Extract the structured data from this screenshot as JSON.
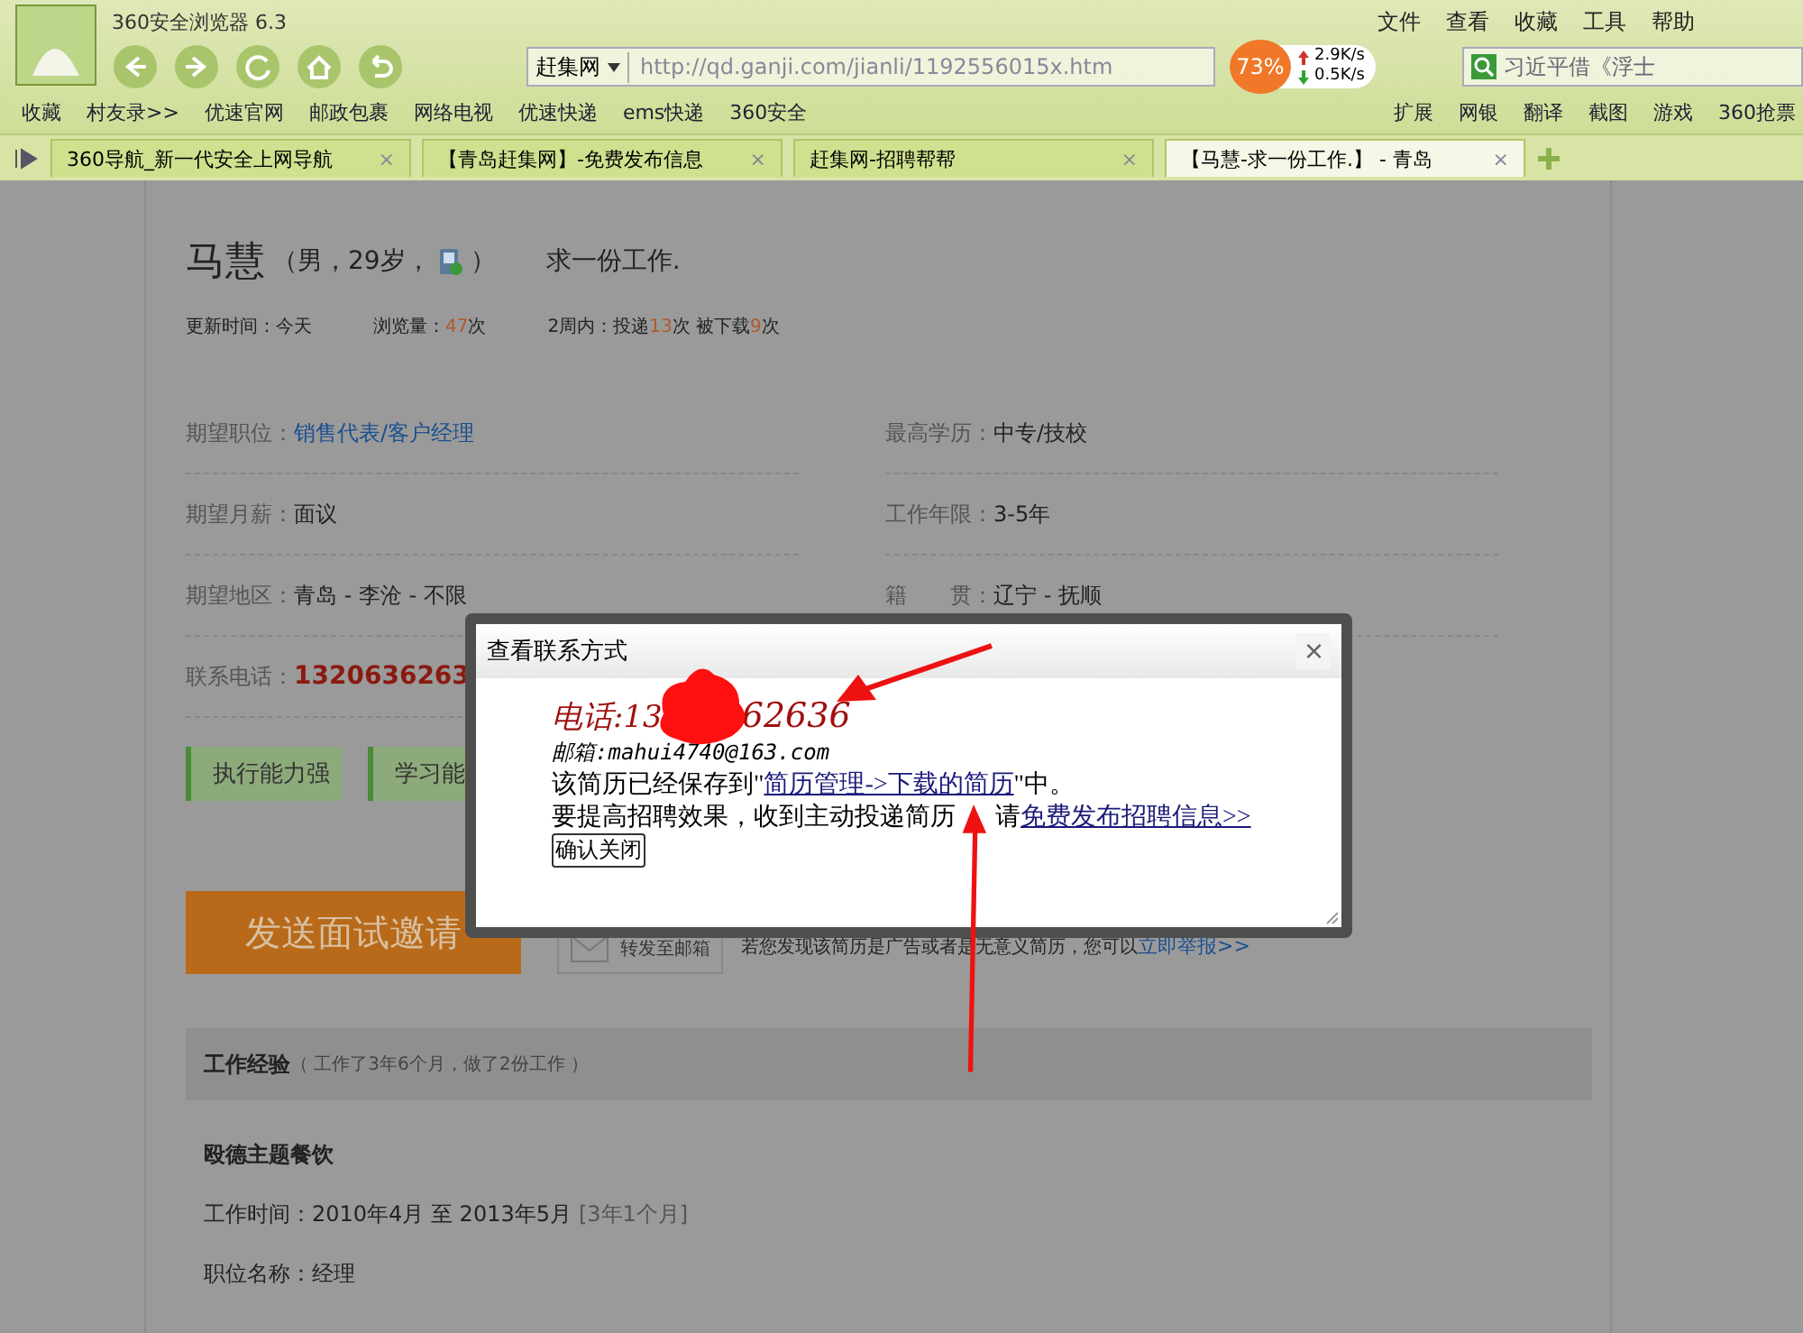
{
  "browser": {
    "title": "360安全浏览器 6.3",
    "menu": [
      "文件",
      "查看",
      "收藏",
      "工具",
      "帮助"
    ],
    "site_dropdown": "赶集网",
    "url": "http://qd.ganji.com/jianli/1192556015x.htm",
    "accelerator": "73%",
    "upload_speed": "2.9K/s",
    "download_speed": "0.5K/s",
    "search": "习近平借《浮士",
    "bookmarks": [
      "收藏",
      "村友录>>",
      "优速官网",
      "邮政包裹",
      "网络电视",
      "优速快递",
      "ems快递",
      "360安全"
    ],
    "tools": [
      "扩展",
      "网银",
      "翻译",
      "截图",
      "游戏",
      "360抢票"
    ],
    "tabs": [
      {
        "label": "360导航_新一代安全上网导航",
        "close": "×",
        "selected": false
      },
      {
        "label": "【青岛赶集网】-免费发布信息",
        "close": "×",
        "selected": false
      },
      {
        "label": "赶集网-招聘帮帮",
        "close": "×",
        "selected": false
      },
      {
        "label": "【马慧-求一份工作.】 - 青岛",
        "close": "×",
        "selected": true
      }
    ]
  },
  "profile": {
    "name": "马慧",
    "details_open": "（男，29岁，",
    "details_close": "）",
    "headline": "求一份工作.",
    "stats": [
      [
        {
          "kind": "text",
          "text": "更新时间：今天"
        }
      ],
      [
        {
          "kind": "text",
          "text": "浏览量："
        },
        {
          "kind": "number",
          "text": "47"
        },
        {
          "kind": "text",
          "text": "次"
        }
      ],
      [
        {
          "kind": "text",
          "text": "2周内：投递"
        },
        {
          "kind": "number",
          "text": "13"
        },
        {
          "kind": "text",
          "text": "次 被下载"
        },
        {
          "kind": "number",
          "text": "9"
        },
        {
          "kind": "text",
          "text": "次"
        }
      ]
    ],
    "fields": [
      {
        "label": "期望职位：",
        "value": "销售代表/客户经理",
        "kind": "link"
      },
      {
        "label": "最高学历：",
        "value": "中专/技校",
        "kind": "plain"
      },
      {
        "label": "期望月薪：",
        "value": "面议",
        "kind": "plain"
      },
      {
        "label": "工作年限：",
        "value": "3-5年",
        "kind": "plain"
      },
      {
        "label": "期望地区：",
        "value": "青岛 - 李沧 - 不限",
        "kind": "plain"
      },
      {
        "label": "籍　　贯：",
        "value": "辽宁 - 抚顺",
        "kind": "plain"
      },
      {
        "label": "联系电话：",
        "value": "1320636263",
        "kind": "phone"
      }
    ],
    "tags": [
      "执行能力强",
      "学习能"
    ],
    "invite_button": "发送面试邀请",
    "forward_button": "转发至邮箱",
    "report_text": "若您发现该简历是广告或者是无意义简历，您可以",
    "report_link": "立即举报>>",
    "section_title": "工作经验",
    "section_note": "（ 工作了3年6个月，做了2份工作 ）",
    "job": {
      "company": "殴德主题餐饮",
      "period_label": "工作时间：2010年4月 至 2013年5月",
      "duration": "[3年1个月]",
      "position": "职位名称：经理"
    }
  },
  "dialog": {
    "title": "查看联系方式",
    "close": "×",
    "phone_start": "电话:13",
    "phone_end": "62636",
    "email": "邮箱:mahui4740@163.com",
    "saved_before": "该简历已经保存到\"",
    "saved_link": "简历管理->下载的简历",
    "saved_after": "\"中。",
    "promo_text": "要提高招聘效果，收到主动投递简历",
    "promo_after": "请",
    "promo_link": "免费发布招聘信息>>",
    "confirm": "确认关闭"
  }
}
